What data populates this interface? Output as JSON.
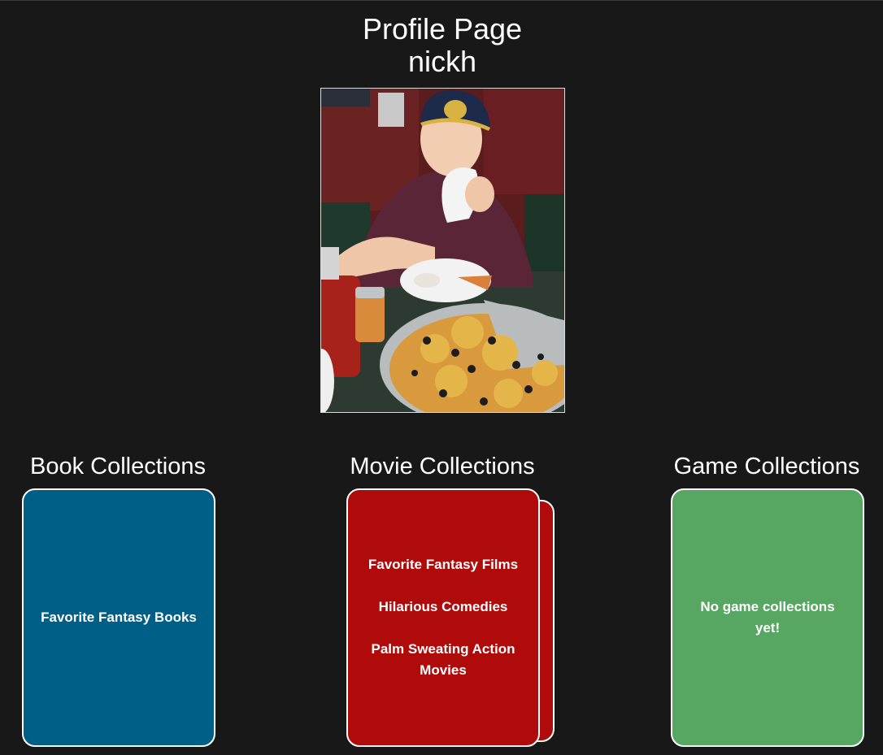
{
  "header": {
    "title": "Profile Page",
    "username": "nickh"
  },
  "profile_photo": {
    "alt": "profile photo"
  },
  "sections": {
    "books": {
      "heading": "Book Collections",
      "items": [
        "Favorite Fantasy Books"
      ],
      "color": "#005f86"
    },
    "movies": {
      "heading": "Movie Collections",
      "items": [
        "Favorite Fantasy Films",
        "Hilarious Comedies",
        "Palm Sweating Action Movies"
      ],
      "color": "#b00b0b"
    },
    "games": {
      "heading": "Game Collections",
      "empty_message": "No game collections yet!",
      "color": "#57a662"
    }
  }
}
